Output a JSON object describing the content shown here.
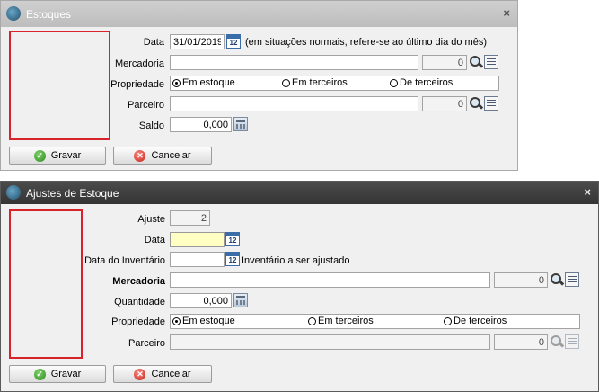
{
  "estoques": {
    "title": "Estoques",
    "close": "×",
    "data_label": "Data",
    "data_value": "31/01/2019",
    "data_hint": "(em situações normais, refere-se ao último dia do mês)",
    "mercadoria_label": "Mercadoria",
    "mercadoria_value": "",
    "mercadoria_code": "0",
    "propriedade_label": "Propriedade",
    "propriedade_options": [
      "Em estoque",
      "Em terceiros",
      "De terceiros"
    ],
    "propriedade_selected": "Em estoque",
    "parceiro_label": "Parceiro",
    "parceiro_value": "",
    "parceiro_code": "0",
    "saldo_label": "Saldo",
    "saldo_value": "0,000",
    "gravar_label": "Gravar",
    "cancelar_label": "Cancelar"
  },
  "ajustes": {
    "title": "Ajustes de Estoque",
    "close": "×",
    "ajuste_label": "Ajuste",
    "ajuste_value": "2",
    "data_label": "Data",
    "data_value": "",
    "data_inventario_label": "Data do Inventário",
    "data_inventario_value": "",
    "data_inventario_hint": "Inventário a ser ajustado",
    "mercadoria_label": "Mercadoria",
    "mercadoria_value": "",
    "mercadoria_code": "0",
    "quantidade_label": "Quantidade",
    "quantidade_value": "0,000",
    "propriedade_label": "Propriedade",
    "propriedade_options": [
      "Em estoque",
      "Em terceiros",
      "De terceiros"
    ],
    "propriedade_selected": "Em estoque",
    "parceiro_label": "Parceiro",
    "parceiro_value": "",
    "parceiro_code": "0",
    "gravar_label": "Gravar",
    "cancelar_label": "Cancelar"
  },
  "icons": {
    "calendar_day": "12",
    "check": "✓",
    "cross": "✕"
  },
  "colors": {
    "highlight_frame": "#d9232c",
    "active_field": "#ffffc4",
    "dark_titlebar": "#3c3c3c"
  }
}
